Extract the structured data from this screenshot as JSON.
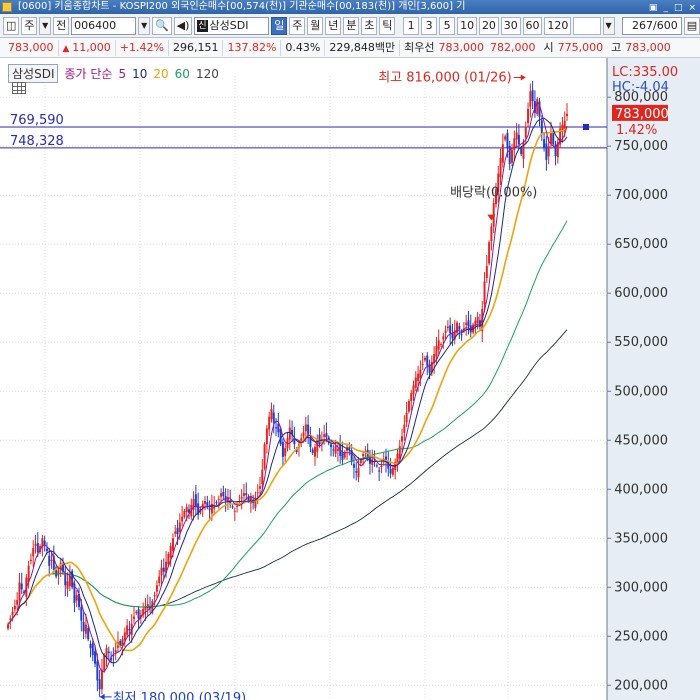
{
  "window": {
    "title": "[0600] 키움종합차트 - KOSPI200 외국인순매수[00,574(천)] 기관순매수[00,183(천)] 개인[3,600] 기",
    "controls": [
      "▣",
      "_",
      "□",
      "×"
    ]
  },
  "toolbar": {
    "mode_buttons": [
      "주",
      "전"
    ],
    "stock_code": "006400",
    "stock_name_tag": "신",
    "stock_name": "삼성SDI",
    "periods": [
      "일",
      "주",
      "월",
      "년",
      "분",
      "초",
      "틱"
    ],
    "active_period": "일",
    "intervals": [
      "1",
      "3",
      "5",
      "10",
      "20",
      "30",
      "60",
      "120"
    ],
    "count": "267",
    "count_total": "/600"
  },
  "quote": {
    "price": "783,000",
    "change": "11,000",
    "change_pct": "+1.42%",
    "volume": "296,151",
    "volume_ratio": "137.82%",
    "turnover": "0.43%",
    "amount": "229,848백만",
    "priority_ask_label": "최우선",
    "priority_ask": "783,000",
    "priority_bid": "782,000",
    "open_label": "시",
    "open": "775,000",
    "high_label": "고",
    "high": "783,000"
  },
  "legend": {
    "stock": "삼성SDI",
    "close_label": "종가 단순",
    "ma_periods": [
      "5",
      "10",
      "20",
      "60",
      "120"
    ]
  },
  "colors": {
    "up": "#e0261e",
    "down": "#1c3fd0",
    "ma5": "#a0148a",
    "ma10": "#1a2a88",
    "ma20": "#f2a20c",
    "ma60": "#19a35a",
    "ma120": "#1c2a4a",
    "hline": "#2a2ab8",
    "axis_bg": "#e6edf5"
  },
  "chart_data": {
    "type": "candlestick",
    "y_unit": "KRW",
    "ylim": [
      185000,
      840000
    ],
    "yticks": [
      200000,
      250000,
      300000,
      350000,
      400000,
      450000,
      500000,
      550000,
      600000,
      650000,
      700000,
      750000,
      800000
    ],
    "ytick_labels": [
      "200,000",
      "250,000",
      "300,000",
      "350,000",
      "400,000",
      "450,000",
      "500,000",
      "550,000",
      "600,000",
      "650,000",
      "700,000",
      "750,000",
      "800,000"
    ],
    "axis_top_labels": [
      "LC:335.00",
      "HC:-4.04"
    ],
    "current_price_label": "783,000",
    "current_change_label": "1.42%",
    "current_price": 783000,
    "horizontal_lines": [
      {
        "value": 769590,
        "label": "769,590"
      },
      {
        "value": 748328,
        "label": "748,328"
      }
    ],
    "annotations": {
      "high": {
        "label": "최고 816,000 (01/26)",
        "value": 816000,
        "bar_index": 226
      },
      "low": {
        "label": "최저 180,000 (03/19)",
        "value": 180000,
        "bar_index": 40
      },
      "ex_dividend": {
        "label": "배당락(0.00%)",
        "bar_index": 211
      }
    },
    "closes": [
      262000,
      268000,
      275000,
      281000,
      287000,
      305000,
      298000,
      294000,
      310000,
      322000,
      328000,
      340000,
      344000,
      336000,
      342000,
      350000,
      343000,
      337000,
      322000,
      328000,
      318000,
      311000,
      317000,
      325000,
      316000,
      302000,
      306000,
      312000,
      300000,
      284000,
      292000,
      280000,
      266000,
      255000,
      262000,
      247000,
      238000,
      231000,
      222000,
      205000,
      196000,
      216000,
      231000,
      238000,
      233000,
      226000,
      230000,
      236000,
      244000,
      240000,
      247000,
      254000,
      261000,
      256000,
      263000,
      270000,
      275000,
      268000,
      272000,
      278000,
      281000,
      283000,
      279000,
      286000,
      292000,
      302000,
      311000,
      320000,
      316000,
      326000,
      334000,
      342000,
      350000,
      357000,
      354000,
      366000,
      372000,
      378000,
      382000,
      376000,
      384000,
      390000,
      382000,
      374000,
      380000,
      385000,
      388000,
      383000,
      379000,
      385000,
      382000,
      386000,
      390000,
      396000,
      393000,
      388000,
      391000,
      386000,
      382000,
      378000,
      383000,
      388000,
      392000,
      396000,
      394000,
      388000,
      393000,
      386000,
      391000,
      397000,
      403000,
      420000,
      446000,
      462000,
      474000,
      482000,
      468000,
      462000,
      458000,
      446000,
      433000,
      442000,
      452000,
      463000,
      456000,
      446000,
      438000,
      446000,
      452000,
      458000,
      466000,
      454000,
      443000,
      437000,
      443000,
      451000,
      446000,
      451000,
      456000,
      453000,
      447000,
      443000,
      440000,
      444000,
      441000,
      434000,
      430000,
      438000,
      443000,
      441000,
      428000,
      422000,
      417000,
      422000,
      430000,
      436000,
      439000,
      432000,
      426000,
      431000,
      428000,
      424000,
      418000,
      424000,
      431000,
      428000,
      421000,
      416000,
      422000,
      428000,
      436000,
      444000,
      454000,
      466000,
      478000,
      490000,
      498000,
      506000,
      514000,
      518000,
      522000,
      528000,
      534000,
      526000,
      519000,
      530000,
      538000,
      546000,
      552000,
      548000,
      556000,
      562000,
      566000,
      559000,
      554000,
      562000,
      570000,
      563000,
      558000,
      564000,
      570000,
      566000,
      560000,
      568000,
      572000,
      576000,
      566000,
      584000,
      612000,
      628000,
      652000,
      668000,
      692000,
      706000,
      722000,
      738000,
      752000,
      760000,
      748000,
      732000,
      746000,
      758000,
      764000,
      752000,
      742000,
      754000,
      770000,
      788000,
      806000,
      796000,
      784000,
      798000,
      780000,
      762000,
      748000,
      736000,
      750000,
      764000,
      752000,
      740000,
      754000,
      768000,
      772000,
      776000,
      783000
    ]
  }
}
